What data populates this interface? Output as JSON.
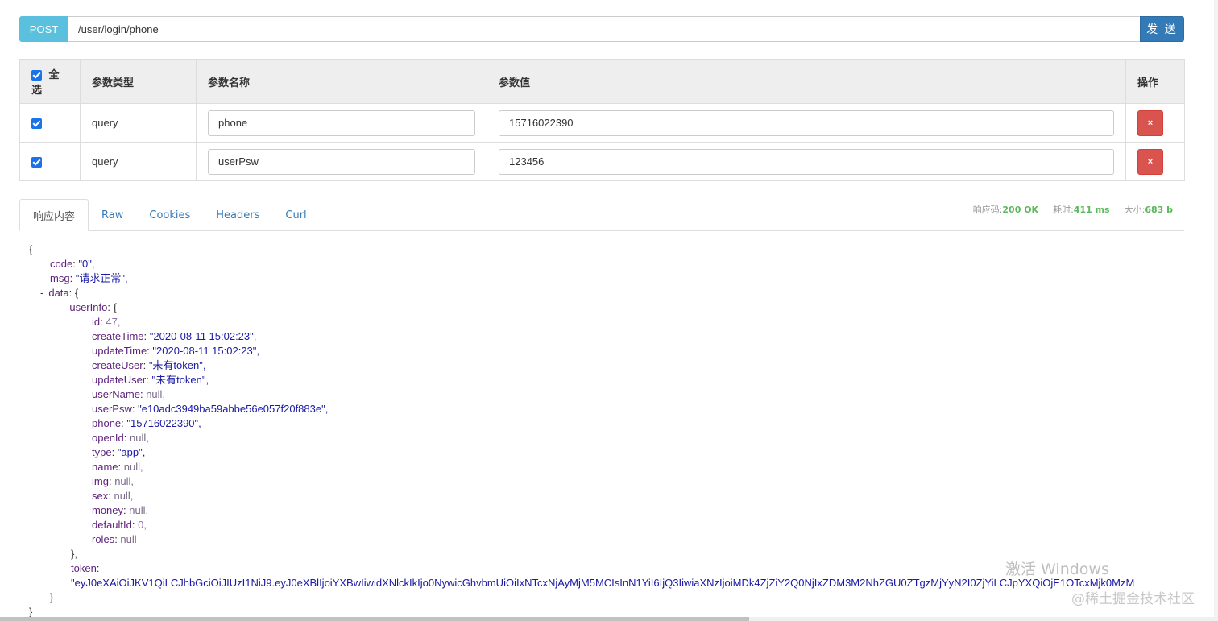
{
  "request": {
    "method": "POST",
    "url": "/user/login/phone",
    "send_label": "发 送"
  },
  "params": {
    "headers": {
      "select_all": "全选",
      "type": "参数类型",
      "name": "参数名称",
      "value": "参数值",
      "action": "操作"
    },
    "rows": [
      {
        "checked": true,
        "type": "query",
        "name": "phone",
        "value": "15716022390"
      },
      {
        "checked": true,
        "type": "query",
        "name": "userPsw",
        "value": "123456"
      }
    ],
    "delete_icon": "×"
  },
  "tabs": [
    {
      "label": "响应内容",
      "active": true
    },
    {
      "label": "Raw"
    },
    {
      "label": "Cookies"
    },
    {
      "label": "Headers"
    },
    {
      "label": "Curl"
    }
  ],
  "stats": {
    "status_label": "响应码:",
    "status_value": "200 OK",
    "time_label": "耗时:",
    "time_value": "411 ms",
    "size_label": "大小:",
    "size_value": "683 b"
  },
  "response": {
    "lines": [
      {
        "indent": 0,
        "toggle": "",
        "key": "",
        "value": "{",
        "vtype": "p"
      },
      {
        "indent": 1,
        "toggle": "",
        "key": "code",
        "value": "\"0\",",
        "vtype": "s"
      },
      {
        "indent": 1,
        "toggle": "",
        "key": "msg",
        "value": "\"请求正常\",",
        "vtype": "s"
      },
      {
        "indent": 1,
        "toggle": "-",
        "key": "data",
        "value": "{",
        "vtype": "p"
      },
      {
        "indent": 2,
        "toggle": "-",
        "key": "userInfo",
        "value": "{",
        "vtype": "p"
      },
      {
        "indent": 3,
        "toggle": "",
        "key": "id",
        "value": "47,",
        "vtype": "n"
      },
      {
        "indent": 3,
        "toggle": "",
        "key": "createTime",
        "value": "\"2020-08-11 15:02:23\",",
        "vtype": "s"
      },
      {
        "indent": 3,
        "toggle": "",
        "key": "updateTime",
        "value": "\"2020-08-11 15:02:23\",",
        "vtype": "s"
      },
      {
        "indent": 3,
        "toggle": "",
        "key": "createUser",
        "value": "\"未有token\",",
        "vtype": "s"
      },
      {
        "indent": 3,
        "toggle": "",
        "key": "updateUser",
        "value": "\"未有token\",",
        "vtype": "s"
      },
      {
        "indent": 3,
        "toggle": "",
        "key": "userName",
        "value": "null,",
        "vtype": "nl"
      },
      {
        "indent": 3,
        "toggle": "",
        "key": "userPsw",
        "value": "\"e10adc3949ba59abbe56e057f20f883e\",",
        "vtype": "s"
      },
      {
        "indent": 3,
        "toggle": "",
        "key": "phone",
        "value": "\"15716022390\",",
        "vtype": "s"
      },
      {
        "indent": 3,
        "toggle": "",
        "key": "openId",
        "value": "null,",
        "vtype": "nl"
      },
      {
        "indent": 3,
        "toggle": "",
        "key": "type",
        "value": "\"app\",",
        "vtype": "s"
      },
      {
        "indent": 3,
        "toggle": "",
        "key": "name",
        "value": "null,",
        "vtype": "nl"
      },
      {
        "indent": 3,
        "toggle": "",
        "key": "img",
        "value": "null,",
        "vtype": "nl"
      },
      {
        "indent": 3,
        "toggle": "",
        "key": "sex",
        "value": "null,",
        "vtype": "nl"
      },
      {
        "indent": 3,
        "toggle": "",
        "key": "money",
        "value": "null,",
        "vtype": "nl"
      },
      {
        "indent": 3,
        "toggle": "",
        "key": "defaultId",
        "value": "0,",
        "vtype": "n"
      },
      {
        "indent": 3,
        "toggle": "",
        "key": "roles",
        "value": "null",
        "vtype": "nl"
      },
      {
        "indent": 2,
        "toggle": "",
        "key": "",
        "value": "},",
        "vtype": "p"
      },
      {
        "indent": 2,
        "toggle": "",
        "key": "token",
        "value": "",
        "vtype": "p"
      },
      {
        "indent": 2,
        "toggle": "",
        "key": "",
        "value": "\"eyJ0eXAiOiJKV1QiLCJhbGciOiJIUzI1NiJ9.eyJ0eXBlIjoiYXBwIiwidXNlckIkIjo0NywicGhvbmUiOiIxNTcxNjAyMjM5MCIsInN1YiI6IjQ3IiwiaXNzIjoiMDk4ZjZiY2Q0NjIxZDM3M2NhZGU0ZTgzMjYyN2I0ZjYiLCJpYXQiOjE1OTcxMjk0MzM",
        "vtype": "s"
      },
      {
        "indent": 1,
        "toggle": "",
        "key": "",
        "value": "}",
        "vtype": "p"
      },
      {
        "indent": 0,
        "toggle": "",
        "key": "",
        "value": "}",
        "vtype": "p"
      }
    ]
  },
  "watermark": "激活 Windows",
  "site_mark": "@稀土掘金技术社区"
}
